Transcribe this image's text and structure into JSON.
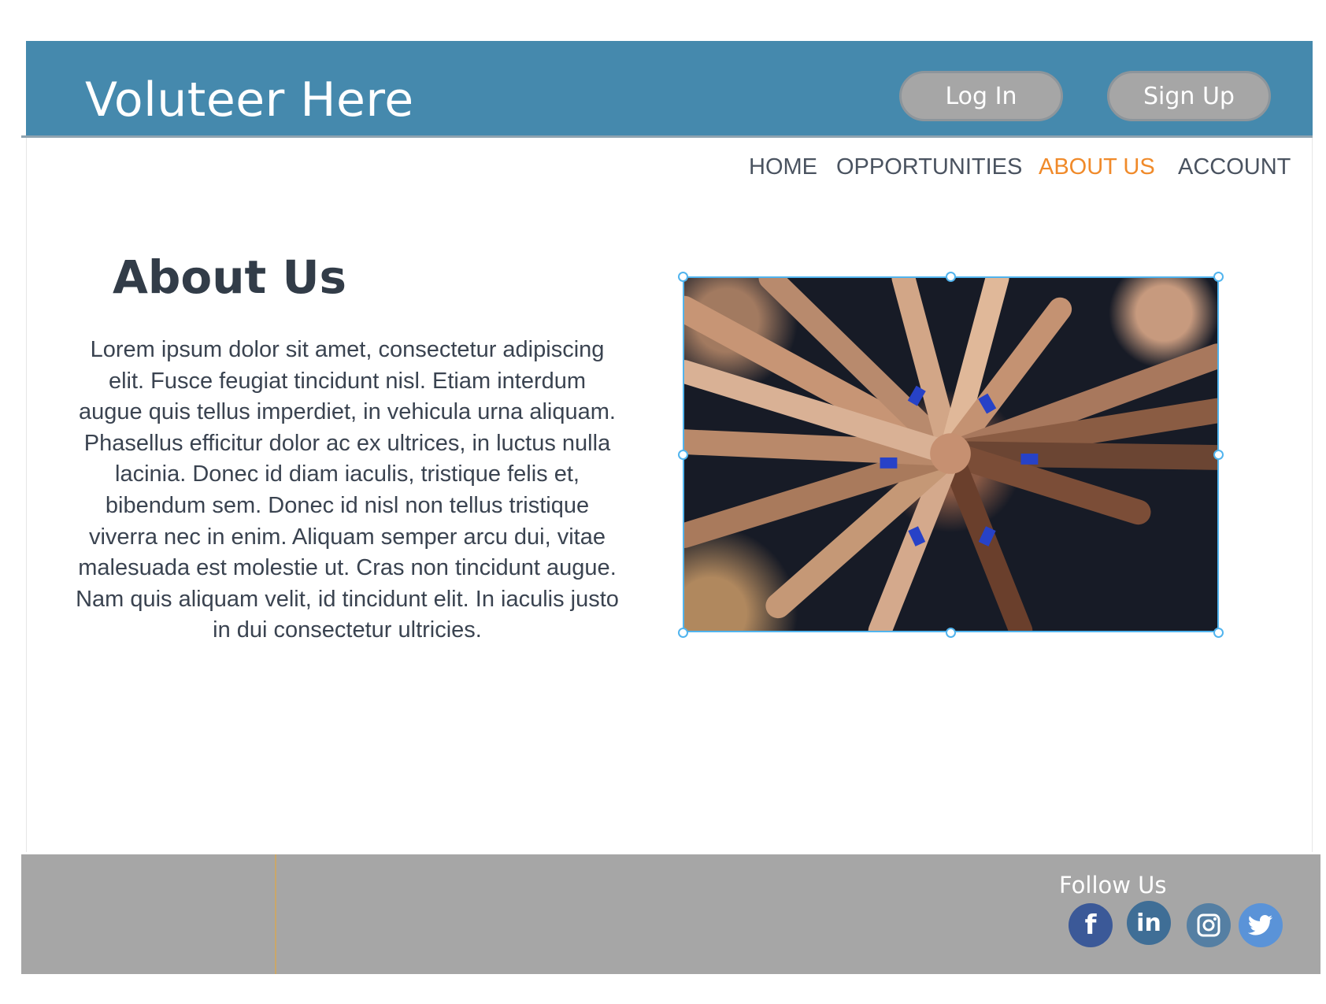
{
  "header": {
    "brand": "Voluteer Here",
    "login_label": "Log In",
    "signup_label": "Sign Up"
  },
  "nav": {
    "items": [
      {
        "label": "HOME"
      },
      {
        "label": "OPPORTUNITIES"
      },
      {
        "label": "ABOUT US"
      },
      {
        "label": "ACCOUNT"
      }
    ],
    "active": "ABOUT US"
  },
  "about": {
    "title": "About Us",
    "body": "Lorem ipsum dolor sit amet, consectetur adipiscing elit. Fusce feugiat tincidunt nisl. Etiam interdum augue quis tellus imperdiet, in vehicula urna aliquam. Phasellus efficitur dolor ac ex ultrices, in luctus nulla lacinia. Donec id diam iaculis, tristique felis et, bibendum sem. Donec id nisl non tellus tristique viverra nec in enim. Aliquam semper arcu dui, vitae malesuada est molestie ut. Cras non tincidunt augue. Nam quis aliquam velit, id tincidunt elit. In iaculis justo in dui consectetur ultricies."
  },
  "footer": {
    "follow_title": "Follow Us",
    "social": [
      {
        "icon": "facebook-icon",
        "glyph": "f",
        "color": "#3b5998"
      },
      {
        "icon": "linkedin-icon",
        "glyph": "in",
        "color": "#3f6e96"
      },
      {
        "icon": "instagram-icon",
        "glyph": "",
        "color": "#557fa3"
      },
      {
        "icon": "twitter-icon",
        "glyph": "",
        "color": "#5a93d8"
      }
    ]
  },
  "colors": {
    "header_bg": "#4589ad",
    "nav_active": "#f08a2a",
    "button_bg": "#a6a6a6",
    "footer_bg": "#a6a6a6",
    "selection": "#51b4ee"
  }
}
